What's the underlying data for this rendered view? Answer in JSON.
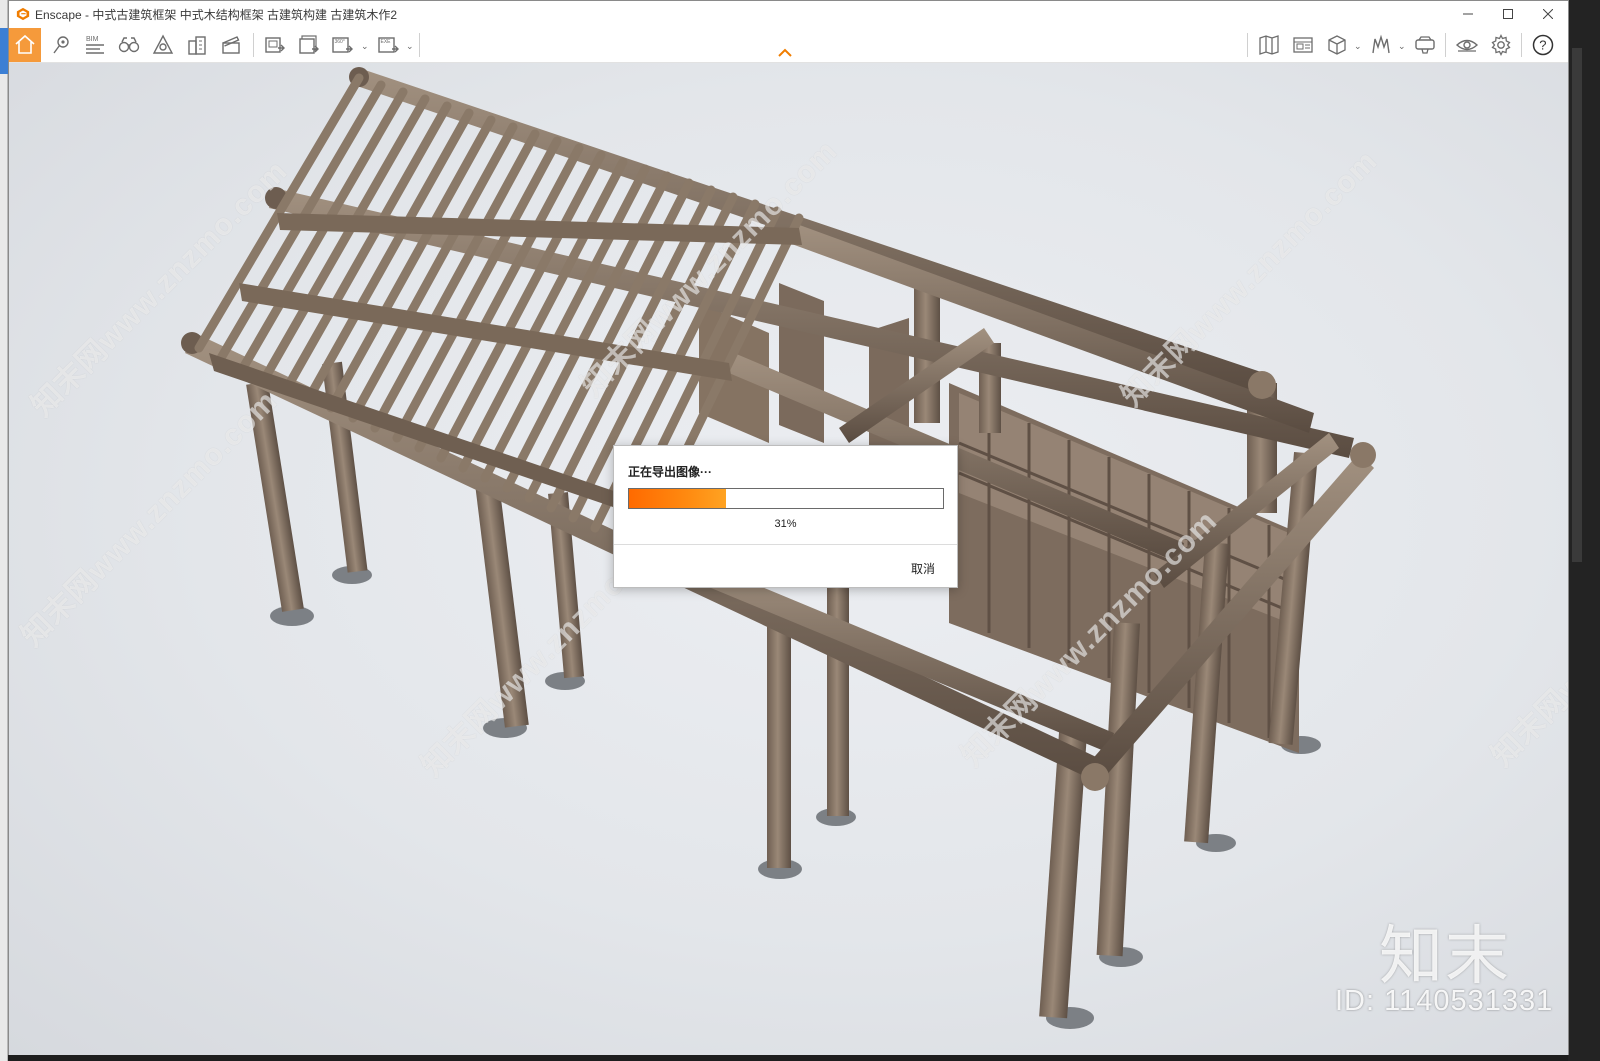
{
  "window": {
    "app_name": "Enscape",
    "title": "Enscape - 中式古建筑框架 中式木结构框架 古建筑构建 古建筑木作2",
    "controls": [
      "minimize",
      "maximize",
      "close"
    ]
  },
  "toolbar": {
    "left_tools": [
      {
        "name": "home-icon",
        "active": true
      },
      {
        "name": "map-pin-icon"
      },
      {
        "name": "bim-icon",
        "label": "BIM"
      },
      {
        "name": "binoculars-icon"
      },
      {
        "name": "object-icon"
      },
      {
        "name": "buildings-icon"
      },
      {
        "name": "clapper-icon"
      },
      {
        "name": "render-image-icon"
      },
      {
        "name": "batch-render-icon"
      },
      {
        "name": "panorama-360-icon",
        "label": "360°"
      },
      {
        "name": "export-exe-icon",
        "label": "EXE"
      }
    ],
    "right_tools": [
      {
        "name": "map-icon"
      },
      {
        "name": "view-management-icon"
      },
      {
        "name": "cube-view-icon"
      },
      {
        "name": "material-editor-icon"
      },
      {
        "name": "vr-headset-icon"
      },
      {
        "name": "eye-icon"
      },
      {
        "name": "settings-gear-icon"
      },
      {
        "name": "help-icon",
        "label": "?"
      }
    ]
  },
  "dialog": {
    "title": "正在导出图像···",
    "progress_percent": 31,
    "progress_label": "31%",
    "cancel_label": "取消",
    "progress_color": "#ff7a00"
  },
  "watermark": {
    "text": "知末网www.znzmo.com",
    "brand": "知末",
    "id_label": "ID: 1140531331"
  },
  "colors": {
    "accent": "#f59a3b",
    "wood": "#8b7968"
  }
}
